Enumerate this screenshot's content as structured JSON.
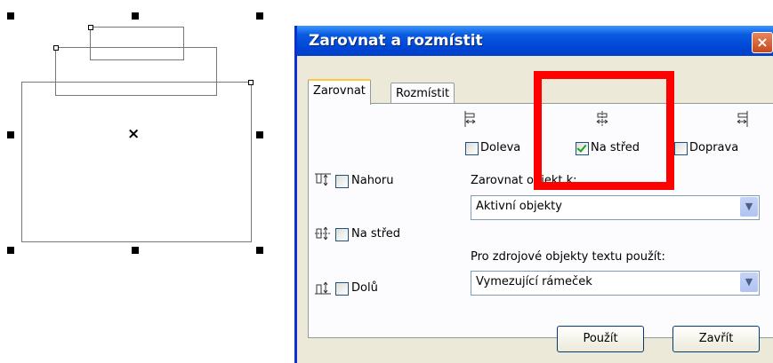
{
  "dialog": {
    "title": "Zarovnat a rozmístit",
    "close_icon": "×"
  },
  "tabs": [
    {
      "label": "Zarovnat",
      "active": true
    },
    {
      "label": "Rozmístit",
      "active": false
    }
  ],
  "horizontal": {
    "left": {
      "label": "Doleva",
      "checked": false
    },
    "center": {
      "label": "Na střed",
      "checked": true
    },
    "right": {
      "label": "Doprava",
      "checked": false
    }
  },
  "vertical": {
    "top": {
      "label": "Nahoru",
      "checked": false
    },
    "middle": {
      "label": "Na střed",
      "checked": false
    },
    "bottom": {
      "label": "Dolů",
      "checked": false
    }
  },
  "align_to": {
    "label": "Zarovnat objekt k:",
    "value": "Aktivní objekty"
  },
  "text_source": {
    "label": "Pro zdrojové objekty textu použít:",
    "value": "Vymezující rámeček"
  },
  "buttons": {
    "apply": "Použít",
    "close": "Zavřít"
  },
  "canvas": {
    "center_marker": "×"
  },
  "colors": {
    "titlebar": "#0046d6",
    "highlight": "#ff0000",
    "dialog_bg": "#ece9d8"
  }
}
